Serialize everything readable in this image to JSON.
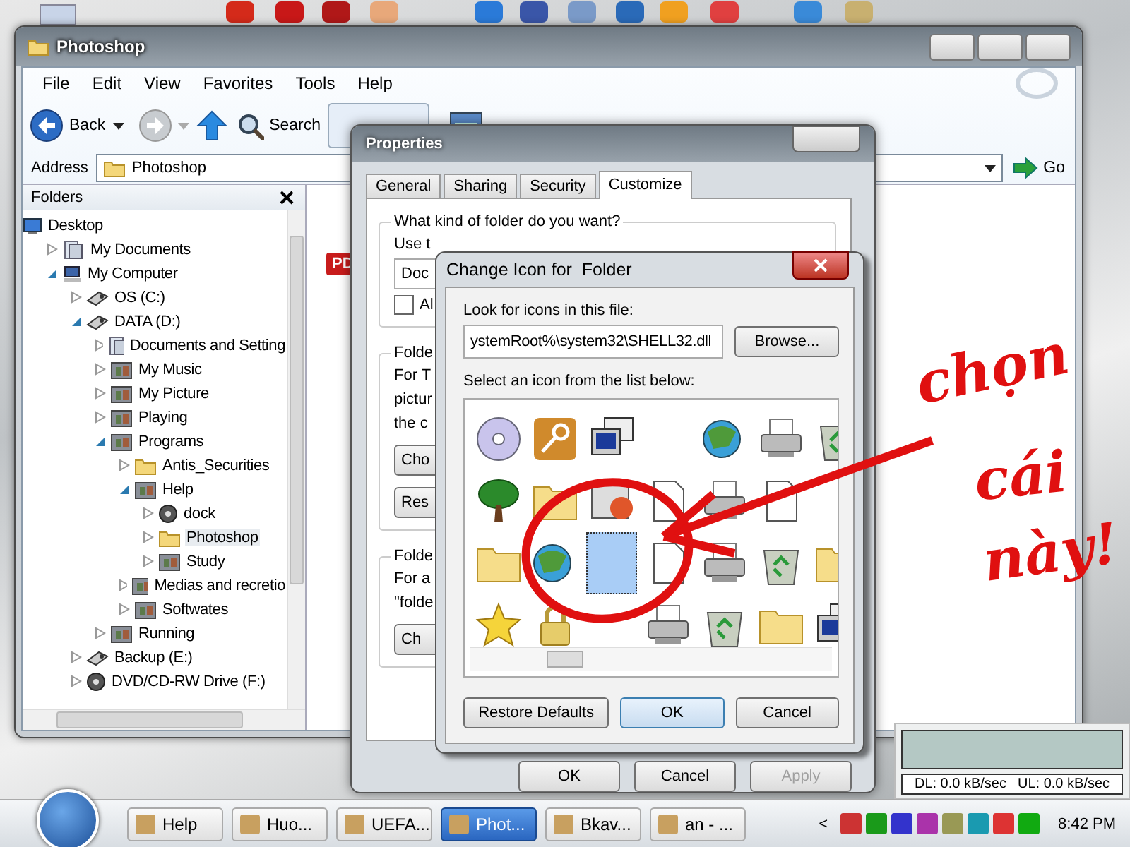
{
  "explorer": {
    "title": "Photoshop",
    "menu": [
      "File",
      "Edit",
      "View",
      "Favorites",
      "Tools",
      "Help"
    ],
    "toolbar": {
      "back": "Back",
      "search": "Search"
    },
    "address": {
      "label": "Address",
      "value": "Photoshop"
    },
    "go": "Go",
    "file_badge": "PD",
    "folders": {
      "title": "Folders",
      "tree": [
        {
          "label": "Desktop",
          "kind": "desktop",
          "selected": false,
          "children": [
            {
              "label": "My Documents",
              "kind": "docs",
              "expanded": false,
              "selected": false
            },
            {
              "label": "My Computer",
              "kind": "computer",
              "expanded": true,
              "selected": false,
              "children": [
                {
                  "label": "OS (C:)",
                  "kind": "drive",
                  "expanded": false,
                  "selected": false
                },
                {
                  "label": "DATA (D:)",
                  "kind": "drive",
                  "expanded": true,
                  "selected": false,
                  "children": [
                    {
                      "label": "Documents and Setting",
                      "kind": "docs",
                      "expanded": false,
                      "selected": false
                    },
                    {
                      "label": "My Music",
                      "kind": "media",
                      "expanded": false,
                      "selected": false
                    },
                    {
                      "label": "My Picture",
                      "kind": "media",
                      "expanded": false,
                      "selected": false
                    },
                    {
                      "label": "Playing",
                      "kind": "media",
                      "expanded": false,
                      "selected": false
                    },
                    {
                      "label": "Programs",
                      "kind": "media",
                      "expanded": true,
                      "selected": false,
                      "children": [
                        {
                          "label": "Antis_Securities",
                          "kind": "folder",
                          "expanded": false,
                          "selected": false
                        },
                        {
                          "label": "Help",
                          "kind": "media",
                          "expanded": true,
                          "selected": false,
                          "children": [
                            {
                              "label": "dock",
                              "kind": "disc",
                              "expanded": false,
                              "selected": false
                            },
                            {
                              "label": "Photoshop",
                              "kind": "folder",
                              "expanded": false,
                              "selected": true
                            },
                            {
                              "label": "Study",
                              "kind": "media",
                              "expanded": false,
                              "selected": false
                            }
                          ]
                        },
                        {
                          "label": "Medias and recretio",
                          "kind": "media",
                          "expanded": false,
                          "selected": false
                        },
                        {
                          "label": "Softwates",
                          "kind": "media",
                          "expanded": false,
                          "selected": false
                        }
                      ]
                    },
                    {
                      "label": "Running",
                      "kind": "media",
                      "expanded": false,
                      "selected": false
                    }
                  ]
                },
                {
                  "label": "Backup (E:)",
                  "kind": "drive",
                  "expanded": false,
                  "selected": false
                },
                {
                  "label": "DVD/CD-RW Drive (F:)",
                  "kind": "disc",
                  "expanded": false,
                  "selected": false
                }
              ]
            }
          ]
        }
      ]
    }
  },
  "properties": {
    "title": "Properties",
    "tabs": [
      {
        "label": "General",
        "selected": false
      },
      {
        "label": "Sharing",
        "selected": false
      },
      {
        "label": "Security",
        "selected": false
      },
      {
        "label": "Customize",
        "selected": true
      }
    ],
    "group_title": "What kind of folder do you want?",
    "use_label": "Use t",
    "template_value": "Doc",
    "checkbox": {
      "label": "Al",
      "checked": false
    },
    "group2": {
      "title": "Folde",
      "lines": [
        "For T",
        "pictur",
        "the c"
      ],
      "buttons": [
        "Cho",
        "Res"
      ]
    },
    "group3": {
      "title": "Folde",
      "lines": [
        "For a",
        "\"folde"
      ],
      "buttons": [
        "Ch"
      ]
    },
    "buttons": [
      {
        "label": "OK",
        "disabled": false
      },
      {
        "label": "Cancel",
        "disabled": false
      },
      {
        "label": "Apply",
        "disabled": true
      }
    ]
  },
  "change_icon": {
    "title": "Change Icon for  Folder",
    "file_label": "Look for icons in this file:",
    "file_value": "ystemRoot%\\system32\\SHELL32.dll",
    "browse": "Browse...",
    "list_label": "Select an icon from the list below:",
    "icons": [
      {
        "kind": "disc",
        "selected": false
      },
      {
        "kind": "key",
        "selected": false
      },
      {
        "kind": "monitor",
        "selected": false
      },
      {
        "kind": "gap"
      },
      {
        "kind": "globe",
        "selected": false
      },
      {
        "kind": "printer",
        "selected": false
      },
      {
        "kind": "recycle",
        "selected": false
      },
      {
        "kind": "tree",
        "selected": false
      },
      {
        "kind": "folder",
        "selected": false
      },
      {
        "kind": "help",
        "selected": false
      },
      {
        "kind": "page",
        "selected": false
      },
      {
        "kind": "printer",
        "selected": false
      },
      {
        "kind": "page",
        "selected": false
      },
      {
        "kind": "gap"
      },
      {
        "kind": "folder",
        "selected": false
      },
      {
        "kind": "globe",
        "selected": false
      },
      {
        "kind": "empty",
        "selected": true
      },
      {
        "kind": "page",
        "selected": false
      },
      {
        "kind": "printer",
        "selected": false
      },
      {
        "kind": "recycle",
        "selected": false
      },
      {
        "kind": "folder",
        "selected": false
      },
      {
        "kind": "star",
        "selected": false
      },
      {
        "kind": "lock",
        "selected": false
      },
      {
        "kind": "gap"
      },
      {
        "kind": "printer",
        "selected": false
      },
      {
        "kind": "recycle",
        "selected": false
      },
      {
        "kind": "folder",
        "selected": false
      },
      {
        "kind": "monitor",
        "selected": false
      }
    ],
    "buttons": [
      {
        "label": "Restore Defaults",
        "default": false
      },
      {
        "label": "OK",
        "default": true
      },
      {
        "label": "Cancel",
        "default": false
      }
    ]
  },
  "annotation": {
    "lines": [
      "chọn",
      "cái",
      "này!"
    ]
  },
  "net_meter": {
    "download": "DL: 0.0 kB/sec",
    "upload": "UL: 0.0 kB/sec"
  },
  "taskbar": {
    "items": [
      {
        "label": "Help",
        "selected": false
      },
      {
        "label": "Huo...",
        "selected": false
      },
      {
        "label": "UEFA...",
        "selected": false
      },
      {
        "label": "Phot...",
        "selected": true
      },
      {
        "label": "Bkav...",
        "selected": false
      },
      {
        "label": "an - ...",
        "selected": false
      }
    ],
    "chevron": "<",
    "clock": "8:42 PM"
  }
}
